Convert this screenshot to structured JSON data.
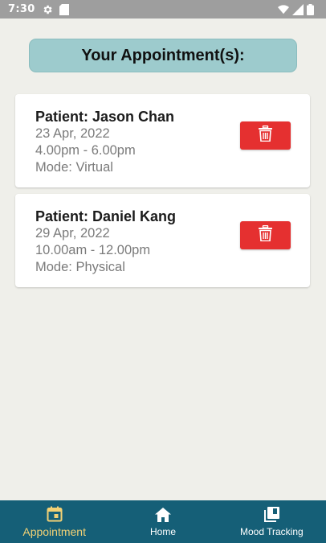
{
  "status_bar": {
    "time": "7:30",
    "icons": [
      "gear-icon",
      "sim-card-icon",
      "wifi-icon",
      "signal-icon",
      "battery-icon"
    ]
  },
  "header": {
    "title": "Your Appointment(s):"
  },
  "appointments": [
    {
      "patient": "Patient: Jason Chan",
      "date": "23 Apr, 2022",
      "time": "4.00pm - 6.00pm",
      "mode": "Mode: Virtual"
    },
    {
      "patient": "Patient: Daniel Kang",
      "date": "29 Apr, 2022",
      "time": "10.00am - 12.00pm",
      "mode": "Mode: Physical"
    }
  ],
  "bottom_nav": {
    "items": [
      {
        "label": "Appointment",
        "icon": "calendar-icon",
        "active": true
      },
      {
        "label": "Home",
        "icon": "home-icon",
        "active": false
      },
      {
        "label": "Mood Tracking",
        "icon": "library-icon",
        "active": false
      }
    ]
  },
  "colors": {
    "header_bg": "#9dcbcd",
    "delete_button": "#e53030",
    "nav_bg": "#155f77",
    "nav_active": "#f2d175",
    "page_bg": "#efefea"
  }
}
